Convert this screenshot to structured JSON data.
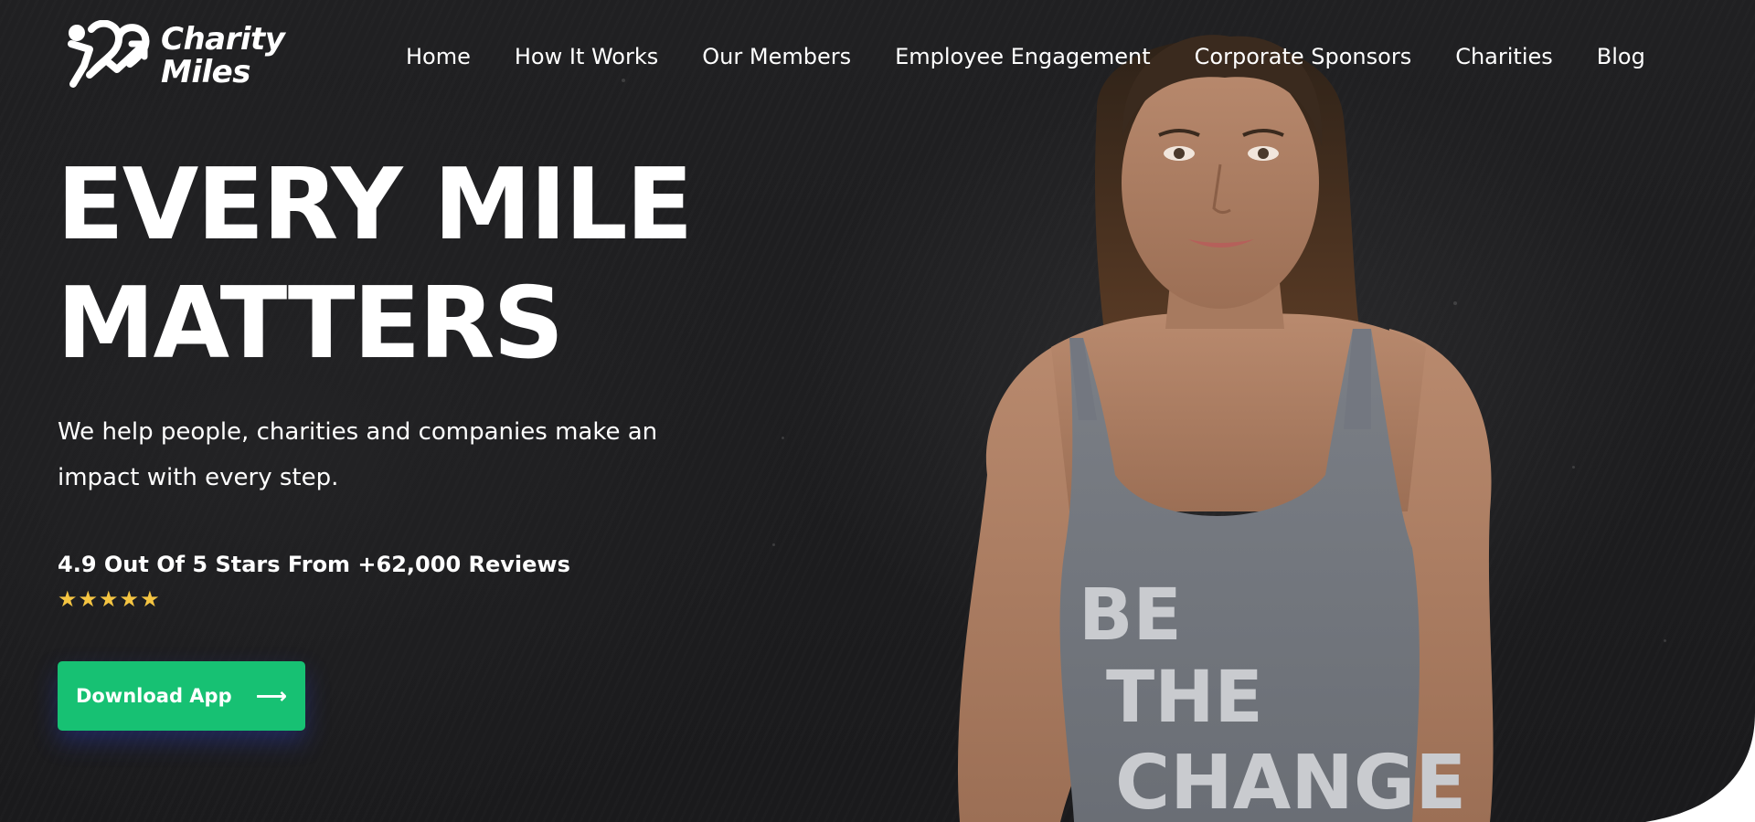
{
  "brand": {
    "line1": "Charity",
    "line2": "Miles"
  },
  "nav": {
    "items": [
      {
        "label": "Home"
      },
      {
        "label": "How It Works"
      },
      {
        "label": "Our Members"
      },
      {
        "label": "Employee Engagement"
      },
      {
        "label": "Corporate Sponsors"
      },
      {
        "label": "Charities"
      },
      {
        "label": "Blog"
      }
    ]
  },
  "hero": {
    "headline_line1": "EVERY MILE",
    "headline_line2": "MATTERS",
    "subtext": "We help people, charities and companies make an impact with every step.",
    "reviews": "4.9 Out Of 5 Stars From +62,000 Reviews",
    "stars": "★★★★★",
    "rating": 5,
    "cta_label": "Download App",
    "cta_icon": "arrow-right-icon",
    "cta_glyph": "⟶"
  },
  "shirt": {
    "line1": "BE",
    "line2": "THE",
    "line3": "CHANGE"
  },
  "colors": {
    "background": "#1c1c1e",
    "cta": "#17c173",
    "stars": "#f5c542",
    "text": "#ffffff"
  }
}
